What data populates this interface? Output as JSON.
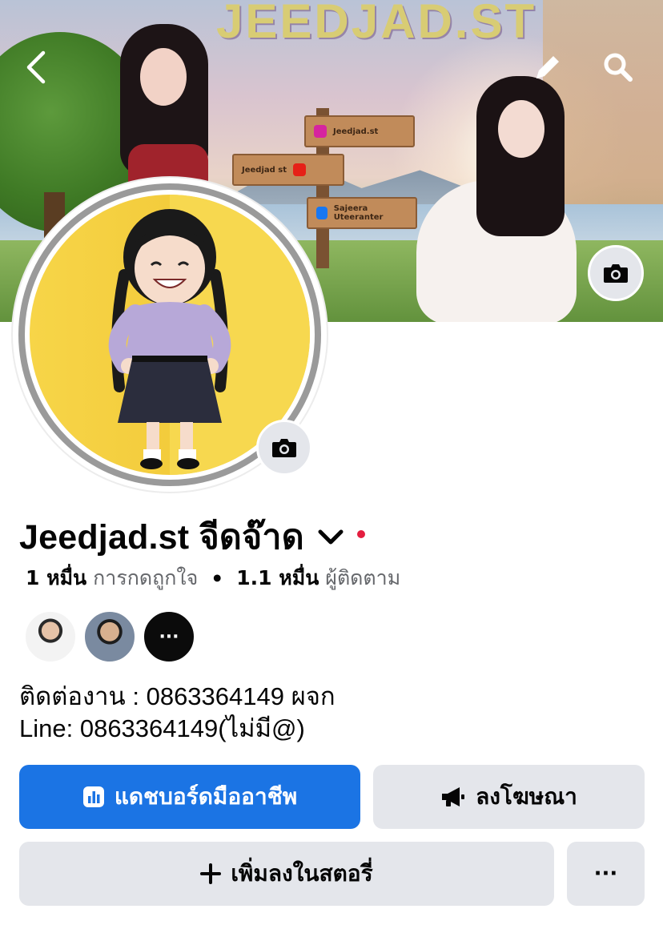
{
  "cover": {
    "watermark": "JEEDJAD.ST",
    "signs": [
      "Jeedjad.st",
      "Jeedjad st",
      "Sajeera Uteeranter"
    ]
  },
  "header": {
    "back_icon": "chevron-left-icon",
    "edit_icon": "pencil-icon",
    "search_icon": "search-icon"
  },
  "profile": {
    "name": "Jeedjad.st จีดจ๊าด",
    "likes_count": "1 หมื่น",
    "likes_label": "การกดถูกใจ",
    "followers_count": "1.1 หมื่น",
    "followers_label": "ผู้ติดตาม",
    "more_friends": "···",
    "bio_line1": "ติดต่องาน : 0863364149 ผจก",
    "bio_line2": "Line: 0863364149(ไม่มี@)"
  },
  "actions": {
    "dashboard_label": "แดชบอร์ดมืออาชีพ",
    "ads_label": "ลงโฆษณา",
    "story_label": "เพิ่มลงในสตอรี่",
    "more_label": "···"
  },
  "colors": {
    "primary": "#1b74e4",
    "secondary_button": "#e4e6eb",
    "text": "#050505",
    "muted": "#65676b",
    "status_dot": "#e41e3f"
  }
}
